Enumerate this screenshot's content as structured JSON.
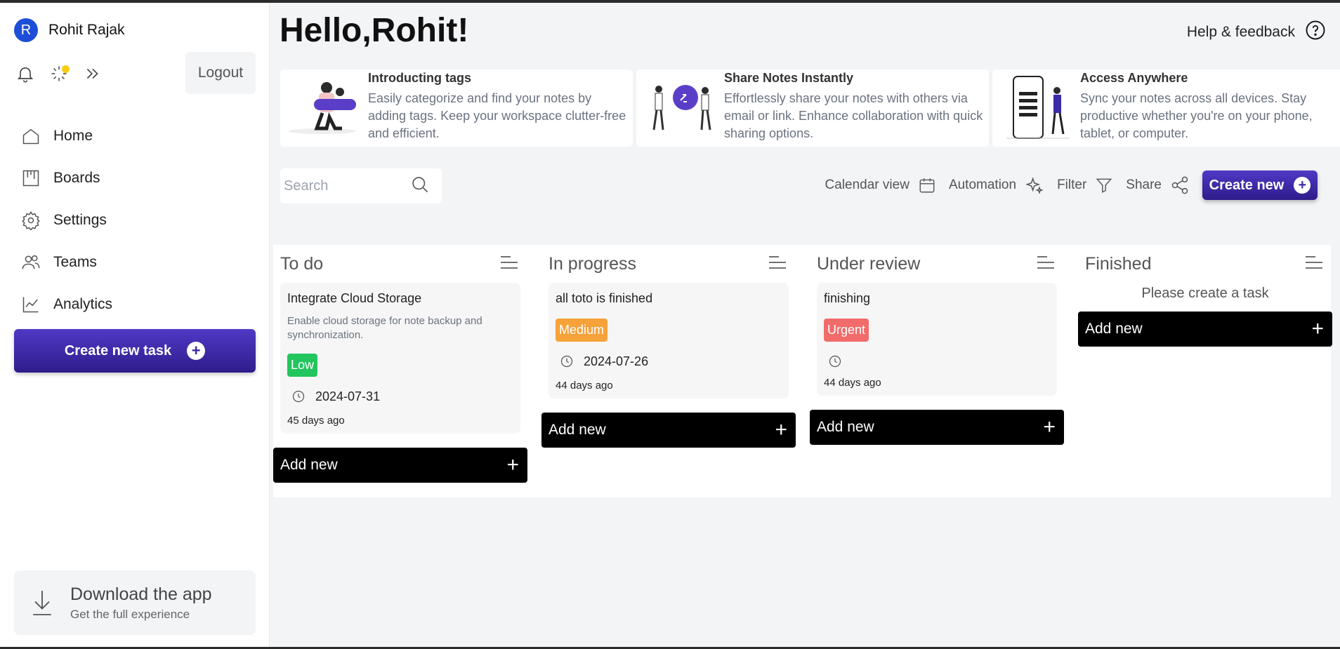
{
  "sidebar": {
    "avatar_initial": "R",
    "user_name": "Rohit Rajak",
    "logout_label": "Logout",
    "nav": [
      {
        "label": "Home",
        "icon": "home-icon"
      },
      {
        "label": "Boards",
        "icon": "boards-icon"
      },
      {
        "label": "Settings",
        "icon": "settings-icon"
      },
      {
        "label": "Teams",
        "icon": "teams-icon"
      },
      {
        "label": "Analytics",
        "icon": "analytics-icon"
      }
    ],
    "create_task_label": "Create new task",
    "download": {
      "title": "Download the app",
      "subtitle": "Get the full experience"
    }
  },
  "header": {
    "greeting": "Hello,Rohit!",
    "help_label": "Help & feedback"
  },
  "features": [
    {
      "title": "Introducting tags",
      "description": "Easily categorize and find your notes by adding tags. Keep your workspace clutter-free and efficient."
    },
    {
      "title": "Share Notes Instantly",
      "description": "Effortlessly share your notes with others via email or link. Enhance collaboration with quick sharing options."
    },
    {
      "title": "Access Anywhere",
      "description": "Sync your notes across all devices. Stay productive whether you're on your phone, tablet, or computer."
    }
  ],
  "search": {
    "placeholder": "Search",
    "value": ""
  },
  "toolbar": {
    "calendar_label": "Calendar view",
    "automation_label": "Automation",
    "filter_label": "Filter",
    "share_label": "Share",
    "create_new_label": "Create new"
  },
  "columns": [
    {
      "title": "To do",
      "add_label": "Add new",
      "card": {
        "title": "Integrate Cloud Storage",
        "description": "Enable cloud storage for note backup and synchronization.",
        "priority": "Low",
        "date": "2024-07-31",
        "ago": "45 days ago"
      }
    },
    {
      "title": "In progress",
      "add_label": "Add new",
      "card": {
        "title": "all toto is finished",
        "priority": "Medium",
        "date": "2024-07-26",
        "ago": "44 days ago"
      }
    },
    {
      "title": "Under review",
      "add_label": "Add new",
      "card": {
        "title": "finishing",
        "priority": "Urgent",
        "date": "",
        "ago": "44 days ago"
      }
    },
    {
      "title": "Finished",
      "add_label": "Add new",
      "empty_text": "Please create a task"
    }
  ],
  "colors": {
    "accent": "#3b2aa8",
    "low": "#22c55e",
    "medium": "#f6a23a",
    "urgent": "#f26b6b",
    "avatar": "#1d4ed8"
  }
}
